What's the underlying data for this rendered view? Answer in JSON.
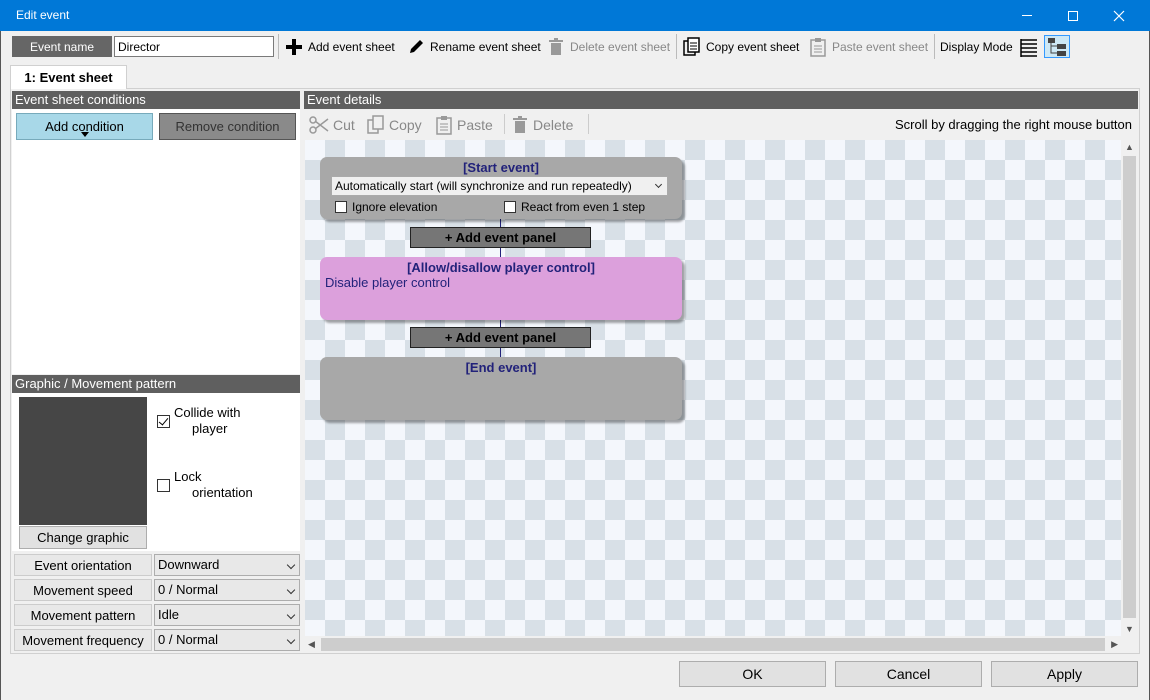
{
  "window": {
    "title": "Edit event"
  },
  "toolbar": {
    "event_name_label": "Event name",
    "event_name_value": "Director",
    "add_sheet": "Add event sheet",
    "rename_sheet": "Rename event sheet",
    "delete_sheet": "Delete event sheet",
    "copy_sheet": "Copy event sheet",
    "paste_sheet": "Paste event sheet",
    "display_mode": "Display Mode"
  },
  "tabs": [
    {
      "label": "1: Event sheet"
    }
  ],
  "left": {
    "conditions_header": "Event sheet conditions",
    "add_condition": "Add condition",
    "remove_condition": "Remove condition",
    "graphic_header": "Graphic / Movement pattern",
    "collide_label_1": "Collide  with",
    "collide_label_2": "player",
    "collide_checked": true,
    "lock_label_1": "Lock",
    "lock_label_2": "orientation",
    "lock_checked": false,
    "change_graphic": "Change graphic",
    "properties": [
      {
        "label": "Event orientation",
        "value": "Downward"
      },
      {
        "label": "Movement speed",
        "value": "0 / Normal"
      },
      {
        "label": "Movement pattern",
        "value": "Idle"
      },
      {
        "label": "Movement frequency",
        "value": "0 / Normal"
      }
    ]
  },
  "right": {
    "details_header": "Event details",
    "cut": "Cut",
    "copy": "Copy",
    "paste": "Paste",
    "delete": "Delete",
    "scroll_hint": "Scroll by dragging the right mouse button",
    "start_panel": {
      "title": "[Start event]",
      "trigger": "Automatically start (will synchronize and run repeatedly)",
      "ignore_elevation": "Ignore elevation",
      "react_step": "React from even 1 step"
    },
    "add_panel_label": "+ Add event panel",
    "allow_panel": {
      "title": "[Allow/disallow player control]",
      "description": "Disable player control"
    },
    "end_panel": {
      "title": "[End event]"
    }
  },
  "footer": {
    "ok": "OK",
    "cancel": "Cancel",
    "apply": "Apply"
  },
  "colors": {
    "titlebar": "#0078d7",
    "section_header": "#5f5f5f",
    "add_condition_bg": "#a8d8e8",
    "event_panel_gray": "#a8a8a8",
    "event_panel_pink": "#dca0dc",
    "panel_title_text": "#22227a"
  }
}
